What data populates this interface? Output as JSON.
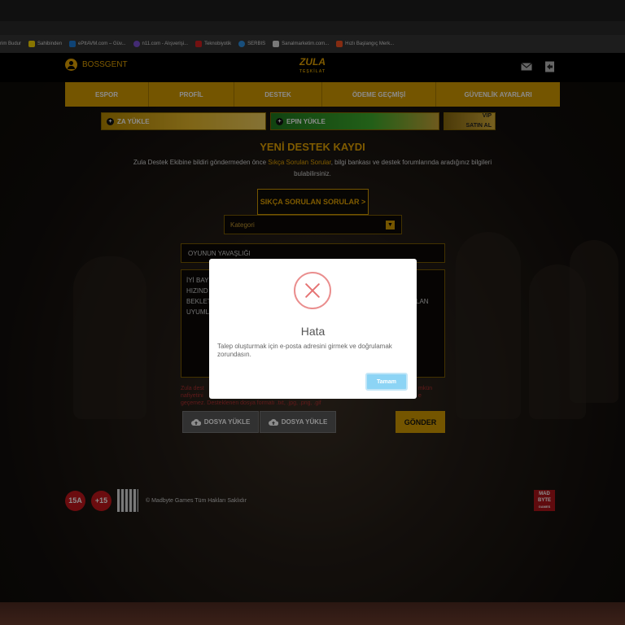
{
  "browser": {
    "bookmarks": [
      {
        "label": "rim Budur",
        "icon": "bookmark-icon",
        "color": "#353535"
      },
      {
        "label": "Sahibinden",
        "icon": "sahibinden-icon",
        "color": "#f7d600"
      },
      {
        "label": "ePttAVM.com – Güv...",
        "icon": "ptt-icon",
        "color": "#1c7bd6"
      },
      {
        "label": "n11.com - Alışverişi...",
        "icon": "n11-icon",
        "color": "#7b4fd1"
      },
      {
        "label": "Teknobiyotik",
        "icon": "tb-icon",
        "color": "#d21f1f"
      },
      {
        "label": "SERBIS",
        "icon": "serbis-icon",
        "color": "#2d8ee0"
      },
      {
        "label": "Sanalmarketim.com...",
        "icon": "page-icon",
        "color": "#dddddd"
      },
      {
        "label": "Hızlı Başlangıç Merk...",
        "icon": "windows-icon",
        "color": "#f25022"
      }
    ]
  },
  "header": {
    "username": "BOSSGENT",
    "logo_text": "ZULA",
    "logo_sub": "TEŞKİLAT"
  },
  "nav": [
    {
      "label": "ESPOR"
    },
    {
      "label": "PROFİL"
    },
    {
      "label": "DESTEK"
    },
    {
      "label": "ÖDEME GEÇMİŞİ"
    },
    {
      "label": "GÜVENLİK AYARLARI"
    }
  ],
  "promos": {
    "za": "ZA YÜKLE",
    "epin": "EPIN YÜKLE",
    "vip_line1": "VIP",
    "vip_line2": "SATIN AL"
  },
  "main": {
    "title": "YENİ DESTEK KAYDI",
    "desc_before": "Zula Destek Ekibine bildiri göndermeden önce ",
    "desc_link": "Sıkça Sorulan Sorular",
    "desc_after": ", bilgi bankası ve destek forumlarında aradığınız bilgileri bulabilirsiniz.",
    "faq_button": "SIKÇA SORULAN SORULAR >",
    "category_placeholder": "Kategori",
    "subject_value": "OYUNUN YAVAŞLIĞI",
    "message_lines": [
      "İYİ BAY",
      "HIZIND",
      "BEKLET",
      "UYUML"
    ],
    "message_right": "LAN",
    "note_left": [
      "Zula dest",
      "nafiyetini",
      "geçemez. Desteklenen dosya formatı .txt, .jpg, .png, .gif"
    ],
    "note_right": [
      "mkün",
      "e"
    ],
    "upload_label": "DOSYA YÜKLE",
    "send_label": "GÖNDER"
  },
  "footer": {
    "age1": "15A",
    "age2": "+15",
    "copyright": "© Madbyte Games Tüm Hakları Saklıdır",
    "madbyte_lines": [
      "MAD",
      "BYTE",
      "GAMES"
    ]
  },
  "modal": {
    "title": "Hata",
    "message": "Talep oluşturmak için e-posta adresini girmek ve doğrulamak zorundasın.",
    "ok_label": "Tamam"
  },
  "colors": {
    "accent": "#d39b00",
    "error": "#e57373",
    "ok_button": "#8cd4f5"
  }
}
